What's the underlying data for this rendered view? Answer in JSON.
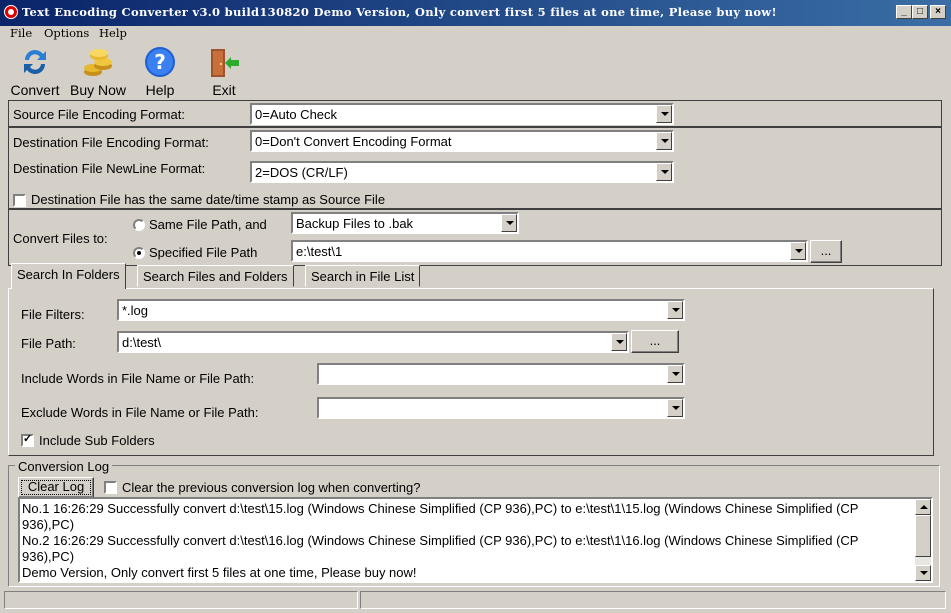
{
  "window": {
    "title": "Text Encoding Converter v3.0 build130820 Demo Version, Only convert first 5 files at one time, Please buy now!",
    "controls": [
      "_",
      "□",
      "×"
    ]
  },
  "menu": {
    "items": [
      "File",
      "Options",
      "Help"
    ]
  },
  "toolbar": {
    "convert": "Convert",
    "buy_now": "Buy Now",
    "help": "Help",
    "exit": "Exit"
  },
  "encoding": {
    "source_label": "Source File Encoding Format:",
    "source_value": "0=Auto Check",
    "dest_label": "Destination File Encoding Format:",
    "dest_value": "0=Don't Convert Encoding Format",
    "newline_label": "Destination File NewLine Format:",
    "newline_value": "2=DOS (CR/LF)",
    "timestamp_label": "Destination File has the same date/time stamp as Source File",
    "timestamp_checked": false
  },
  "convert_to": {
    "label": "Convert Files to:",
    "same_path_label": "Same File Path, and",
    "backup_value": "Backup Files to .bak",
    "specified_path_label": "Specified File Path",
    "specified_path_value": "e:\\test\\1",
    "selected": "specified",
    "browse": "..."
  },
  "tabs": [
    "Search In Folders",
    "Search Files and Folders",
    "Search in File List"
  ],
  "search": {
    "filters_label": "File Filters:",
    "filters_value": "*.log",
    "path_label": "File Path:",
    "path_value": "d:\\test\\",
    "browse": "...",
    "include_label": "Include Words in File Name or File Path:",
    "include_value": "",
    "exclude_label": "Exclude Words in File Name or File Path:",
    "exclude_value": "",
    "subfolders_label": "Include Sub Folders",
    "subfolders_checked": true
  },
  "log": {
    "title": "Conversion Log",
    "clear_button": "Clear Log",
    "clear_option_label": "Clear the previous conversion log when converting?",
    "lines": [
      "No.1 16:26:29 Successfully convert d:\\test\\15.log (Windows Chinese Simplified (CP 936),PC) to e:\\test\\1\\15.log (Windows Chinese Simplified (CP 936),PC)",
      "No.2 16:26:29 Successfully convert d:\\test\\16.log (Windows Chinese Simplified (CP 936),PC) to e:\\test\\1\\16.log (Windows Chinese Simplified (CP 936),PC)",
      "Demo Version, Only convert first 5 files at one time, Please buy now!"
    ]
  },
  "icons": {
    "convert": "convert-arrows-icon",
    "buy_now": "gold-coins-icon",
    "help": "help-question-icon",
    "exit": "exit-door-icon"
  }
}
